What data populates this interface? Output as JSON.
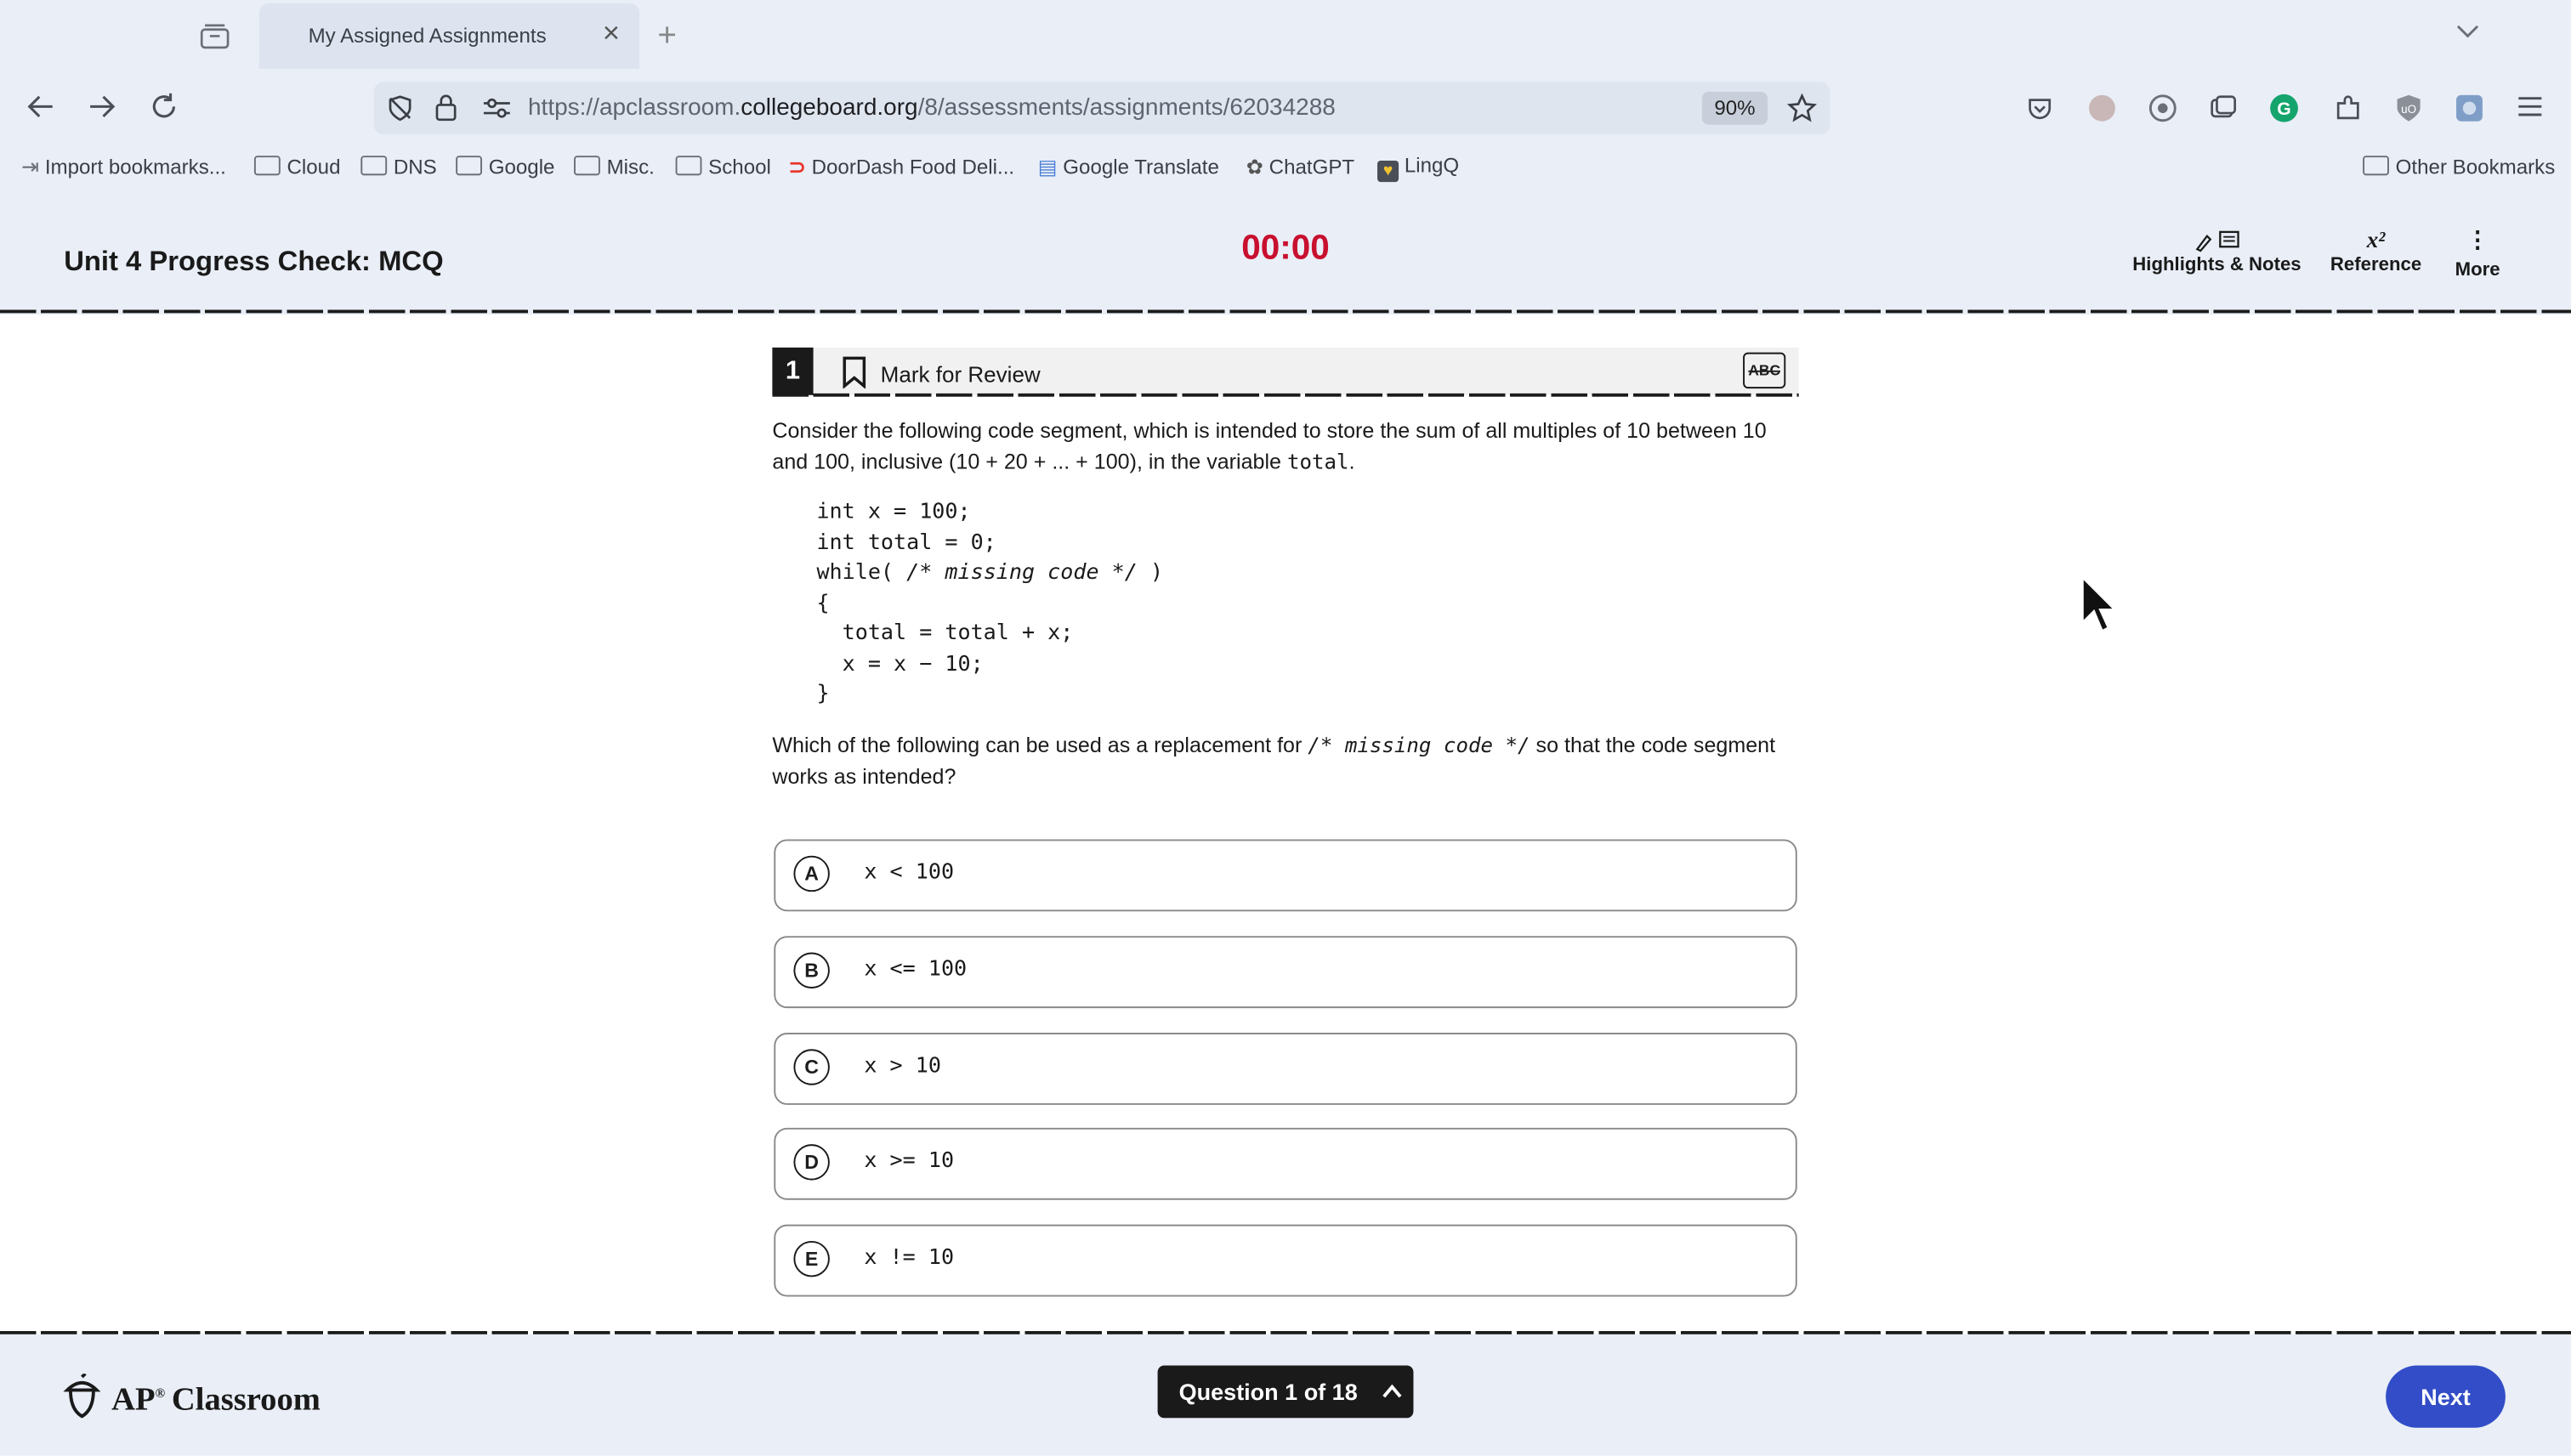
{
  "browser": {
    "tab_title": "My Assigned Assignments",
    "url_scheme": "https://apclassroom.",
    "url_host": "collegeboard.org",
    "url_path": "/8/assessments/assignments/62034288",
    "zoom": "90%",
    "bookmarks": [
      {
        "label": "Import bookmarks...",
        "icon": "import-icon"
      },
      {
        "label": "Cloud",
        "icon": "folder-icon"
      },
      {
        "label": "DNS",
        "icon": "folder-icon"
      },
      {
        "label": "Google",
        "icon": "folder-icon"
      },
      {
        "label": "Misc.",
        "icon": "folder-icon"
      },
      {
        "label": "School",
        "icon": "folder-icon"
      },
      {
        "label": "DoorDash Food Deli...",
        "icon": "doordash-icon"
      },
      {
        "label": "Google Translate",
        "icon": "translate-icon"
      },
      {
        "label": "ChatGPT",
        "icon": "chatgpt-icon"
      },
      {
        "label": "LingQ",
        "icon": "lingq-icon"
      }
    ],
    "other_bookmarks": "Other Bookmarks"
  },
  "header": {
    "title": "Unit 4 Progress Check: MCQ",
    "timer": "00:00",
    "highlights_label": "Highlights & Notes",
    "reference_label": "Reference",
    "more_label": "More"
  },
  "question": {
    "number": "1",
    "mark_review_label": "Mark for Review",
    "abc_label": "ABC",
    "prompt_pre": "Consider the following code segment, which is intended to store the sum of all multiples of 10 between 10 and 100, inclusive (10 + 20 + ... + 100), in the variable ",
    "prompt_var": "total",
    "prompt_post": ".",
    "code": {
      "line1": "int x = 100;",
      "line2": "int total = 0;",
      "line3_pre": "while( ",
      "line3_comment": "/* missing code */",
      "line3_post": " )",
      "line4": "{",
      "line5": "  total = total + x;",
      "line6": "  x = x − 10;",
      "line7": "}"
    },
    "ask_pre": "Which of the following can be used as a replacement for ",
    "ask_code": "/* missing code */",
    "ask_post": " so that the code segment works as intended?",
    "choices": [
      {
        "letter": "A",
        "text": "x < 100"
      },
      {
        "letter": "B",
        "text": "x <= 100"
      },
      {
        "letter": "C",
        "text": "x > 10"
      },
      {
        "letter": "D",
        "text": "x >= 10"
      },
      {
        "letter": "E",
        "text": "x != 10"
      }
    ]
  },
  "footer": {
    "logo_ap": "AP",
    "logo_classroom": "Classroom",
    "question_nav": "Question 1 of 18",
    "next_label": "Next"
  },
  "colors": {
    "timer": "#c8102e",
    "next_button": "#324dc7",
    "chrome_bg": "#e9eef7"
  }
}
